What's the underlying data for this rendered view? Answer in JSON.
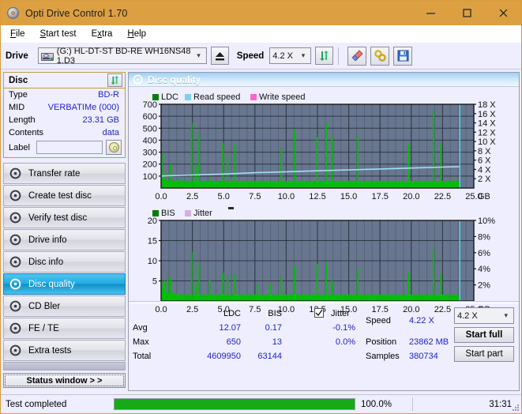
{
  "window": {
    "title": "Opti Drive Control 1.70",
    "icon": "disc-icon",
    "minimize": "minimize-icon",
    "maximize": "maximize-icon",
    "close": "close-icon",
    "titlebar_color": "#dca043"
  },
  "menu": {
    "items": [
      {
        "label": "File",
        "accel": "F"
      },
      {
        "label": "Start test",
        "accel": "S"
      },
      {
        "label": "Extra",
        "accel": "x"
      },
      {
        "label": "Help",
        "accel": "H"
      }
    ]
  },
  "toolbar": {
    "drive_label": "Drive",
    "drive_value": "(G:)  HL-DT-ST BD-RE  WH16NS48 1.D3",
    "eject_icon": "eject-icon",
    "speed_label": "Speed",
    "speed_value": "4.2 X",
    "refresh_icon": "refresh-arrows-icon",
    "eraser_icon": "eraser-icon",
    "chain_icon": "chain-link-icon",
    "save_icon": "floppy-save-icon"
  },
  "disc_panel": {
    "title": "Disc",
    "refresh_icon": "refresh-arrows-icon",
    "rows": [
      {
        "key": "Type",
        "value": "BD-R"
      },
      {
        "key": "MID",
        "value": "VERBATIMe (000)"
      },
      {
        "key": "Length",
        "value": "23.31 GB"
      },
      {
        "key": "Contents",
        "value": "data"
      }
    ],
    "label_key": "Label",
    "label_value": "",
    "label_placeholder": "",
    "label_button_icon": "disc-icon"
  },
  "nav": {
    "items": [
      {
        "label": "Transfer rate",
        "icon": "disc-icon",
        "selected": false
      },
      {
        "label": "Create test disc",
        "icon": "disc-icon",
        "selected": false
      },
      {
        "label": "Verify test disc",
        "icon": "disc-icon",
        "selected": false
      },
      {
        "label": "Drive info",
        "icon": "disc-icon",
        "selected": false
      },
      {
        "label": "Disc info",
        "icon": "disc-icon",
        "selected": false
      },
      {
        "label": "Disc quality",
        "icon": "disc-icon",
        "selected": true
      },
      {
        "label": "CD Bler",
        "icon": "disc-icon",
        "selected": false
      },
      {
        "label": "FE / TE",
        "icon": "disc-icon",
        "selected": false
      },
      {
        "label": "Extra tests",
        "icon": "disc-icon",
        "selected": false
      }
    ],
    "status_window_button": "Status window > >"
  },
  "content": {
    "header_title": "Disc quality",
    "header_icon": "disc-icon"
  },
  "stats": {
    "col_ldc": "LDC",
    "col_bis": "BIS",
    "jitter_label": "Jitter",
    "jitter_checked": true,
    "rows": [
      {
        "label": "Avg",
        "ldc": "12.07",
        "bis": "0.17",
        "jitter": "-0.1%"
      },
      {
        "label": "Max",
        "ldc": "650",
        "bis": "13",
        "jitter": "0.0%"
      },
      {
        "label": "Total",
        "ldc": "4609950",
        "bis": "63144",
        "jitter": ""
      }
    ],
    "speed_label": "Speed",
    "speed_value": "4.22 X",
    "position_label": "Position",
    "position_value": "23862 MB",
    "samples_label": "Samples",
    "samples_value": "380734",
    "speed_select": "4.2 X",
    "start_full": "Start full",
    "start_part": "Start part"
  },
  "statusbar": {
    "text": "Test completed",
    "progress_pct": 100,
    "progress_label": "100.0%",
    "elapsed": "31:31",
    "progress_color": "#17aa17"
  },
  "chart_data": [
    {
      "type": "line",
      "id": "ldc-chart",
      "title": "",
      "xlabel": "GB",
      "ylabel": "",
      "grid": true,
      "legend_position": "top-left",
      "legend": [
        {
          "name": "LDC",
          "color": "#008000"
        },
        {
          "name": "Read speed",
          "color": "#7ad2f0"
        },
        {
          "name": "Write speed",
          "color": "#ff66cc"
        }
      ],
      "xlim": [
        0,
        25.0
      ],
      "xticks": [
        "0.0",
        "2.5",
        "5.0",
        "7.5",
        "10.0",
        "12.5",
        "15.0",
        "17.5",
        "20.0",
        "22.5",
        "25.0"
      ],
      "ylim": [
        0,
        700
      ],
      "yticks": [
        "100",
        "200",
        "300",
        "400",
        "500",
        "600",
        "700"
      ],
      "y2lim": [
        0,
        18
      ],
      "y2ticks": [
        "2 X",
        "4 X",
        "6 X",
        "8 X",
        "10 X",
        "12 X",
        "14 X",
        "16 X",
        "18 X"
      ],
      "series": [
        {
          "name": "LDC",
          "color": "#00c000",
          "note": "dense green spike column plot, baseline ~60, spikes up to 650",
          "values": [
            295,
            75,
            120,
            60,
            70,
            60,
            200,
            60,
            65,
            60,
            70,
            60,
            80,
            60,
            60,
            60,
            60,
            60,
            60,
            60,
            545,
            60,
            60,
            185,
            60,
            460,
            60,
            60,
            60,
            60,
            60,
            60,
            95,
            60,
            60,
            60,
            60,
            60,
            60,
            60,
            60,
            380,
            60,
            60,
            280,
            60,
            60,
            60,
            60,
            365,
            60,
            60,
            60,
            60,
            60,
            60,
            60,
            60,
            60,
            60,
            60,
            60,
            60,
            60,
            60,
            60,
            60,
            60,
            60,
            60,
            60,
            60,
            60,
            60,
            60,
            60,
            60,
            60,
            60,
            60,
            335,
            60,
            60,
            60,
            60,
            60,
            60,
            60,
            60,
            490,
            60,
            60,
            60,
            60,
            60,
            60,
            60,
            60,
            60,
            60,
            60,
            60,
            60,
            60,
            425,
            60,
            60,
            60,
            60,
            60,
            545,
            60,
            60,
            60,
            425,
            60,
            60,
            60,
            60,
            60,
            60,
            60,
            60,
            60,
            60,
            60,
            60,
            60,
            60,
            60,
            60,
            435,
            60,
            60,
            60,
            60,
            60,
            60,
            60,
            60,
            60,
            60,
            60,
            60,
            60,
            60,
            60,
            60,
            60,
            60,
            60,
            60,
            60,
            60,
            60,
            60,
            60,
            60,
            60,
            60,
            60,
            60,
            60,
            60,
            60,
            365,
            60,
            60,
            60,
            60,
            60,
            60,
            60,
            60,
            60,
            60,
            60,
            60,
            60,
            60,
            60,
            60,
            650,
            60,
            60,
            60,
            60,
            375,
            60,
            60,
            60,
            60,
            60,
            60,
            60,
            60,
            60,
            60,
            60,
            60
          ]
        },
        {
          "name": "Read speed",
          "color": "#9fe0f5",
          "unit": "X",
          "note": "rising CAV read speed curve on right axis",
          "x": [
            0.0,
            2.5,
            5.0,
            7.5,
            10.0,
            12.5,
            15.0,
            17.5,
            20.0,
            22.5,
            23.9
          ],
          "values": [
            2.6,
            2.8,
            3.0,
            3.3,
            3.5,
            3.7,
            3.9,
            4.1,
            4.3,
            4.5,
            4.6
          ]
        }
      ]
    },
    {
      "type": "line",
      "id": "bis-chart",
      "title": "",
      "xlabel": "GB",
      "ylabel": "",
      "grid": true,
      "legend_position": "top-left",
      "legend": [
        {
          "name": "BIS",
          "color": "#008000"
        },
        {
          "name": "Jitter",
          "color": "#d8aedd"
        }
      ],
      "xlim": [
        0,
        25.0
      ],
      "xticks": [
        "0.0",
        "2.5",
        "5.0",
        "7.5",
        "10.0",
        "12.5",
        "15.0",
        "17.5",
        "20.0",
        "22.5",
        "25.0"
      ],
      "ylim": [
        0,
        20
      ],
      "yticks": [
        "5",
        "10",
        "15",
        "20"
      ],
      "y2lim": [
        0,
        10
      ],
      "y2ticks": [
        "2%",
        "4%",
        "6%",
        "8%",
        "10%"
      ],
      "series": [
        {
          "name": "BIS",
          "color": "#00c000",
          "note": "dense green spike column plot, baseline ~1.6, spikes up to 13",
          "values": [
            4.8,
            3.2,
            5.0,
            2.0,
            6.0,
            2.0,
            5.5,
            2.0,
            2.0,
            1.8,
            1.8,
            1.6,
            1.6,
            1.6,
            1.6,
            1.6,
            1.6,
            1.6,
            1.6,
            1.6,
            12.2,
            1.6,
            1.6,
            4.2,
            1.6,
            9.2,
            1.6,
            1.6,
            1.6,
            1.6,
            1.6,
            1.6,
            5.2,
            1.6,
            1.6,
            1.6,
            1.6,
            1.6,
            1.6,
            1.6,
            1.6,
            7.0,
            1.6,
            1.6,
            6.6,
            1.6,
            1.6,
            1.6,
            1.6,
            6.6,
            1.6,
            1.6,
            1.6,
            1.6,
            1.6,
            1.6,
            1.6,
            1.6,
            1.6,
            1.6,
            1.6,
            1.6,
            1.6,
            1.6,
            4.2,
            1.6,
            1.6,
            1.6,
            1.6,
            1.6,
            1.6,
            1.6,
            1.6,
            4.2,
            1.6,
            1.6,
            1.6,
            1.6,
            1.6,
            1.6,
            6.2,
            1.6,
            1.6,
            1.6,
            1.6,
            1.6,
            1.6,
            1.6,
            1.6,
            8.8,
            1.6,
            1.6,
            1.6,
            1.6,
            1.6,
            1.6,
            1.6,
            1.6,
            1.6,
            1.6,
            1.6,
            1.6,
            1.6,
            1.6,
            9.2,
            1.6,
            1.6,
            1.6,
            1.6,
            1.6,
            9.2,
            1.6,
            1.6,
            1.6,
            5.0,
            1.6,
            1.6,
            1.6,
            1.6,
            1.6,
            1.6,
            1.6,
            1.6,
            1.6,
            1.6,
            1.6,
            1.6,
            1.6,
            1.6,
            1.6,
            1.6,
            8.2,
            1.6,
            1.6,
            1.6,
            1.6,
            1.6,
            1.6,
            1.6,
            1.6,
            1.6,
            1.6,
            1.6,
            1.6,
            1.6,
            1.6,
            1.6,
            1.6,
            1.6,
            1.6,
            1.6,
            1.6,
            1.6,
            1.6,
            1.6,
            1.6,
            1.6,
            1.6,
            1.6,
            1.6,
            1.6,
            1.6,
            1.6,
            1.6,
            1.6,
            7.0,
            1.6,
            1.6,
            1.6,
            1.6,
            1.6,
            1.6,
            1.6,
            1.6,
            1.6,
            1.6,
            1.6,
            1.6,
            1.6,
            1.6,
            1.6,
            1.6,
            13.0,
            1.6,
            1.6,
            1.6,
            1.6,
            6.8,
            1.6,
            1.6,
            1.6,
            1.6,
            1.6,
            1.6,
            1.6,
            1.6,
            1.6,
            1.6,
            1.6,
            1.6
          ]
        }
      ]
    }
  ]
}
